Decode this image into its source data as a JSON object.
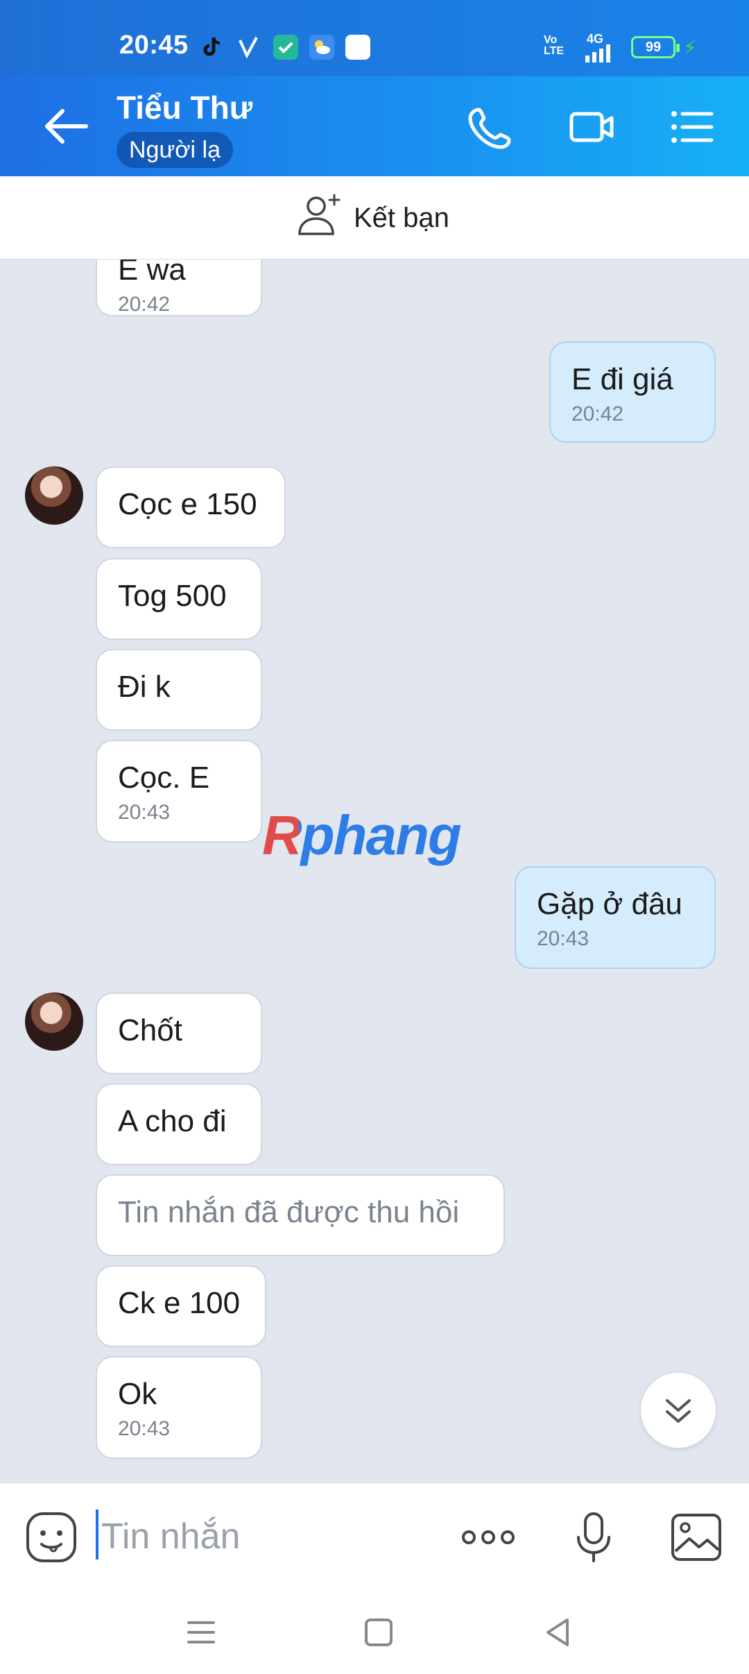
{
  "status_bar": {
    "time": "20:45",
    "battery": "99",
    "network": "4G",
    "volte": "Vo LTE",
    "colors": {
      "bg": "#1f6fd6",
      "battery": "#7CFC8A"
    }
  },
  "header": {
    "contact_name": "Tiểu Thư",
    "badge": "Người lạ",
    "icons": [
      "back-arrow-icon",
      "phone-icon",
      "video-call-icon",
      "menu-list-icon"
    ]
  },
  "friend_bar": {
    "label": "Kết bạn",
    "icon": "add-friend-icon"
  },
  "messages": [
    {
      "from": "them",
      "text": "E wa",
      "time": "20:42"
    },
    {
      "from": "me",
      "text": "E đi giá",
      "time": "20:42"
    },
    {
      "from": "them",
      "text": "Cọc e 150",
      "time": ""
    },
    {
      "from": "them",
      "text": "Tog 500",
      "time": ""
    },
    {
      "from": "them",
      "text": "Đi k",
      "time": ""
    },
    {
      "from": "them",
      "text": "Cọc. E",
      "time": "20:43"
    },
    {
      "from": "me",
      "text": "Gặp ở đâu",
      "time": "20:43"
    },
    {
      "from": "them",
      "text": "Chốt",
      "time": ""
    },
    {
      "from": "them",
      "text": "A cho đi",
      "time": ""
    },
    {
      "from": "them",
      "text": "Tin nhắn đã được thu hồi",
      "time": "",
      "recalled": true
    },
    {
      "from": "them",
      "text": "Ck e 100",
      "time": ""
    },
    {
      "from": "them",
      "text": "Ok",
      "time": "20:43"
    }
  ],
  "watermark": "Rphang",
  "input_bar": {
    "placeholder": "Tin nhắn",
    "icons": [
      "emoji-icon",
      "more-icon",
      "microphone-icon",
      "image-icon"
    ]
  },
  "nav": {
    "icons": [
      "recent-apps-icon",
      "home-icon",
      "back-icon"
    ]
  },
  "colors": {
    "accent": "#1a8ff0",
    "my_bubble": "#d5ecfd",
    "chat_bg": "#e2e7ef"
  }
}
